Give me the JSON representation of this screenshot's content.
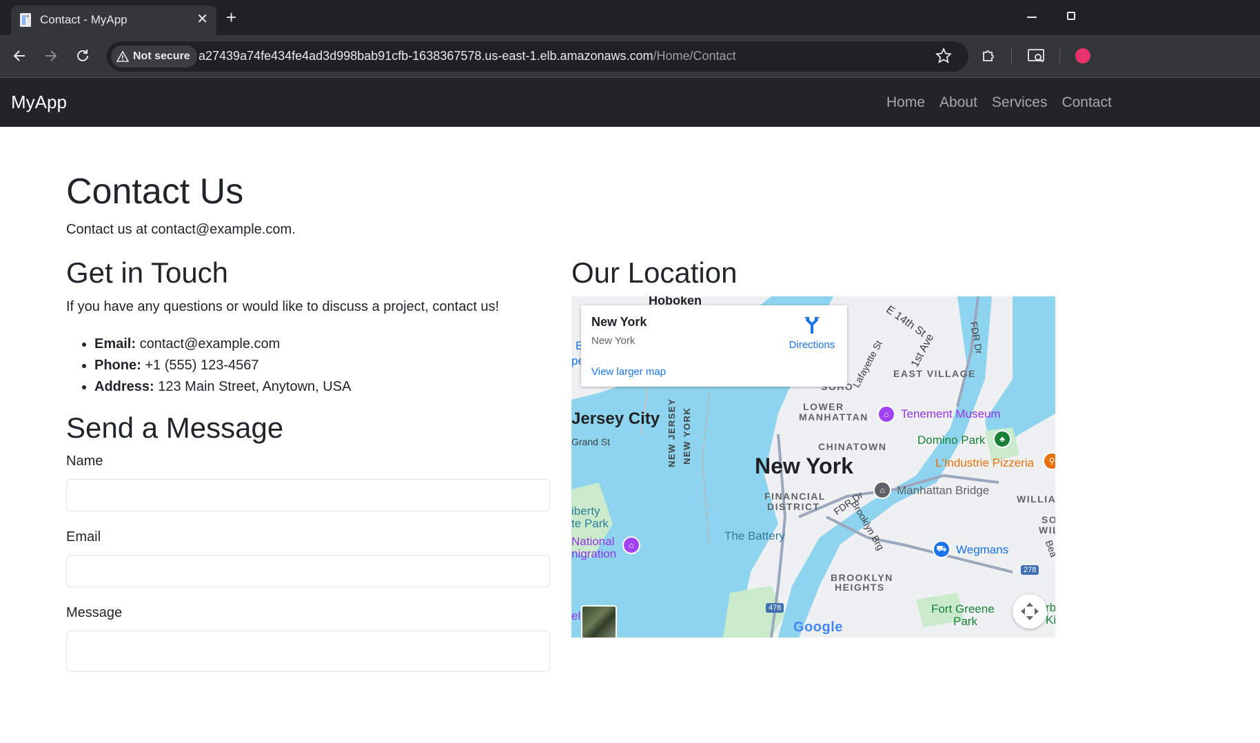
{
  "browser": {
    "tab_title": "Contact - MyApp",
    "security_label": "Not secure",
    "url_host": "a27439a74fe434fe4ad3d998bab91cfb-1638367578.us-east-1.elb.amazonaws.com",
    "url_path": "/Home/Contact"
  },
  "navbar": {
    "brand": "MyApp",
    "links": [
      "Home",
      "About",
      "Services",
      "Contact"
    ]
  },
  "page": {
    "title": "Contact Us",
    "lead": "Contact us at contact@example.com.",
    "get_in_touch": {
      "heading": "Get in Touch",
      "intro": "If you have any questions or would like to discuss a project, contact us!",
      "items": [
        {
          "label": "Email:",
          "value": " contact@example.com"
        },
        {
          "label": "Phone:",
          "value": " +1 (555) 123-4567"
        },
        {
          "label": "Address:",
          "value": " 123 Main Street, Anytown, USA"
        }
      ]
    },
    "form": {
      "heading": "Send a Message",
      "name_label": "Name",
      "name_value": "",
      "email_label": "Email",
      "email_value": "",
      "message_label": "Message"
    },
    "location": {
      "heading": "Our Location"
    }
  },
  "map": {
    "card": {
      "title": "New York",
      "subtitle": "New York",
      "directions": "Directions",
      "larger_map": "View larger map"
    },
    "labels": {
      "hoboken": "Hoboken",
      "e14": "E 14th St",
      "first_ave": "1st Ave",
      "fdr": "FDR Dr",
      "east_village": "EAST VILLAGE",
      "lafayette": "Lafayette St",
      "soho": "SOHO",
      "lower_manhattan_1": "LOWER",
      "lower_manhattan_2": "MANHATTAN",
      "tenement": "Tenement Museum",
      "jersey_city": "Jersey City",
      "grand_st": "Grand St",
      "chinatown": "CHINATOWN",
      "domino": "Domino Park",
      "new_york": "New York",
      "lindustrie": "L'Industrie Pizzeria",
      "nj": "NEW JERSEY",
      "ny": "NEW YORK",
      "financial_1": "FINANCIAL",
      "financial_2": "DISTRICT",
      "fdr_dr2": "FDR Dr",
      "manhattan_bridge": "Manhattan Bridge",
      "williamsburg": "WILLIAI",
      "liberty_1": "iberty",
      "liberty_2": "te Park",
      "battery": "The Battery",
      "brooklyn_brg": "Brooklyn Brg",
      "so": "SO",
      "willia2": "WILLIA",
      "national_1": "National",
      "national_2": "nigration",
      "wegmans": "Wegmans",
      "bea": "Bea",
      "i278": "278",
      "brooklyn_h1": "BROOKLYN",
      "brooklyn_h2": "HEIGHTS",
      "i478": "478",
      "fort_greene_1": "Fort Greene",
      "fort_greene_2": "Park",
      "rb": "rb",
      "ki": "Ki",
      "e_left": "E",
      "pe_left": "pe",
      "el_left": "el",
      "google": "Google"
    }
  },
  "colors": {
    "chrome_dark": "#202124",
    "chrome_tab": "#35363a",
    "navbar_bg": "#212529",
    "water": "#8fd4ee",
    "land": "#eef0f2",
    "park": "#c9ebcc",
    "map_link": "#1a73e8"
  }
}
